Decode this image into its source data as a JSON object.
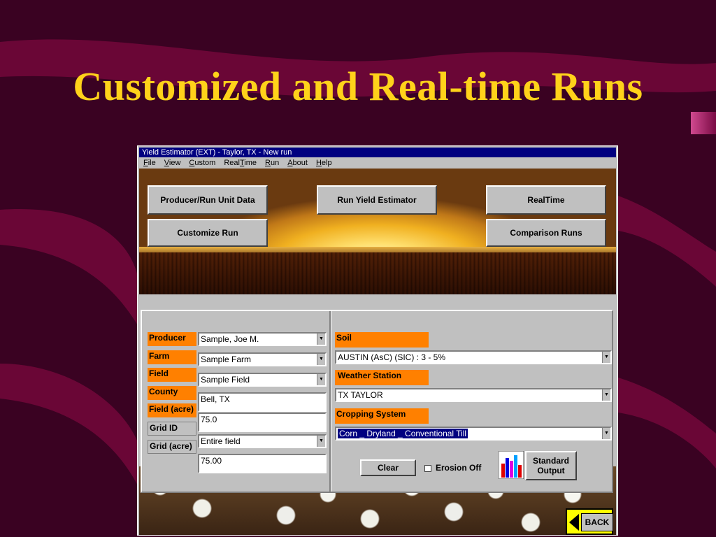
{
  "slide": {
    "title": "Customized and Real-time Runs"
  },
  "window": {
    "title": "Yield Estimator (EXT) - Taylor, TX  - New run"
  },
  "menu": [
    {
      "label": "File",
      "key": "F",
      "rest": "ile"
    },
    {
      "label": "View",
      "key": "V",
      "rest": "iew"
    },
    {
      "label": "Custom",
      "key": "C",
      "rest": "ustom"
    },
    {
      "label": "RealTime",
      "pre": "Real",
      "key": "T",
      "rest": "ime"
    },
    {
      "label": "Run",
      "key": "R",
      "rest": "un"
    },
    {
      "label": "About",
      "key": "A",
      "rest": "bout"
    },
    {
      "label": "Help",
      "key": "H",
      "rest": "elp"
    }
  ],
  "buttons": {
    "producer": "Producer/Run Unit Data",
    "run": "Run Yield Estimator",
    "realtime": "RealTime",
    "customize": "Customize Run",
    "comparison": "Comparison Runs",
    "clear": "Clear",
    "standard_output_line1": "Standard",
    "standard_output_line2": "Output",
    "back": "BACK"
  },
  "left_fields": {
    "producer": {
      "label": "Producer",
      "value": "Sample, Joe M."
    },
    "farm": {
      "label": "Farm",
      "value": "Sample Farm"
    },
    "field": {
      "label": "Field",
      "value": "Sample Field"
    },
    "county": {
      "label": "County",
      "value": "Bell, TX"
    },
    "field_acre": {
      "label": "Field (acre)",
      "value": "75.0"
    },
    "grid_id": {
      "label": "Grid ID",
      "value": "Entire field"
    },
    "grid_acre": {
      "label": "Grid (acre)",
      "value": "75.00"
    }
  },
  "right_fields": {
    "soil": {
      "label": "Soil",
      "value": "AUSTIN (AsC) (SIC) : 3 - 5%"
    },
    "weather": {
      "label": "Weather Station",
      "value": "TX TAYLOR"
    },
    "cropping": {
      "label": "Cropping System",
      "value": "Corn _ Dryland _ Conventional Till"
    }
  },
  "erosion": {
    "label": "Erosion Off",
    "checked": false
  },
  "colors": {
    "accent_orange": "#ff8000",
    "title_yellow": "#ffd21a",
    "titlebar": "#000080"
  }
}
